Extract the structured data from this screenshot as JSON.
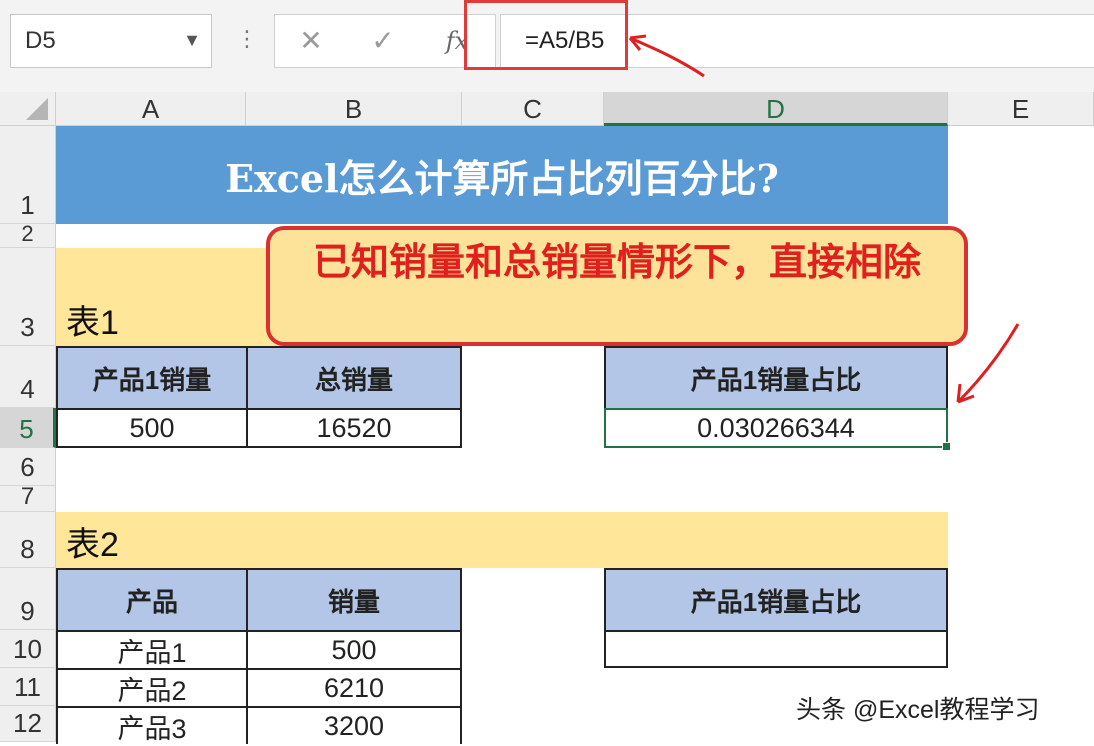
{
  "formula_bar": {
    "name_box": "D5",
    "formula": "=A5/B5",
    "fx_label": "fx"
  },
  "columns": [
    "A",
    "B",
    "C",
    "D",
    "E"
  ],
  "rows": [
    "1",
    "2",
    "3",
    "4",
    "5",
    "6",
    "7",
    "8",
    "9",
    "10",
    "11",
    "12"
  ],
  "sheet": {
    "title": "Excel怎么计算所占比列百分比?",
    "callout": "已知销量和总销量情形下，直接相除",
    "table1": {
      "label": "表1",
      "headers": [
        "产品1销量",
        "总销量"
      ],
      "values": [
        "500",
        "16520"
      ],
      "result_header": "产品1销量占比",
      "result_value": "0.030266344"
    },
    "table2": {
      "label": "表2",
      "headers": [
        "产品",
        "销量"
      ],
      "rows": [
        [
          "产品1",
          "500"
        ],
        [
          "产品2",
          "6210"
        ],
        [
          "产品3",
          "3200"
        ]
      ],
      "result_header": "产品1销量占比",
      "result_value": ""
    }
  },
  "watermark": "头条 @Excel教程学习",
  "colors": {
    "title_band": "#5b9bd5",
    "header_fill": "#b4c6e7",
    "label_band": "#ffe699",
    "callout_border": "#d93030",
    "callout_text": "#e0201c",
    "selection": "#217346"
  }
}
